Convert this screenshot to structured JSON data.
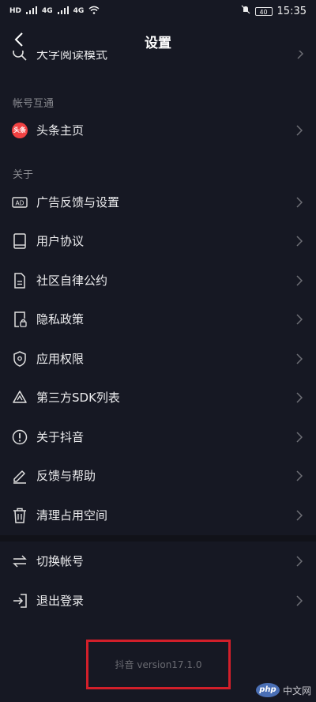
{
  "status_bar": {
    "left_tags": [
      "HD",
      "4G",
      "4G"
    ],
    "time": "15:35",
    "battery": "40",
    "icons": [
      "signal-icon",
      "wifi-icon",
      "mute-bell-icon",
      "battery-icon"
    ]
  },
  "header": {
    "title": "设置",
    "back_icon": "chevron-left-icon"
  },
  "partial_item": {
    "label": "大字阅读模式",
    "icon": "search-icon"
  },
  "sections": {
    "account_link_label": "帐号互通",
    "about_label": "关于"
  },
  "account_items": [
    {
      "label": "头条主页",
      "icon": "toutiao-logo-icon",
      "badge": "头条"
    }
  ],
  "about_items": [
    {
      "label": "广告反馈与设置",
      "icon": "ad-icon"
    },
    {
      "label": "用户协议",
      "icon": "book-icon"
    },
    {
      "label": "社区自律公约",
      "icon": "document-icon"
    },
    {
      "label": "隐私政策",
      "icon": "privacy-lock-icon"
    },
    {
      "label": "应用权限",
      "icon": "shield-icon"
    },
    {
      "label": "第三方SDK列表",
      "icon": "recycle-icon"
    },
    {
      "label": "关于抖音",
      "icon": "info-circle-icon"
    },
    {
      "label": "反馈与帮助",
      "icon": "pencil-icon"
    },
    {
      "label": "清理占用空间",
      "icon": "trash-icon"
    }
  ],
  "account_actions": [
    {
      "label": "切换帐号",
      "icon": "switch-arrows-icon"
    },
    {
      "label": "退出登录",
      "icon": "logout-icon"
    }
  ],
  "footer": {
    "version": "抖音 version17.1.0",
    "highlight_color": "#d21f2a"
  },
  "watermark": {
    "logo": "php",
    "text": "中文网"
  },
  "colors": {
    "background": "#161823",
    "text": "#ececee",
    "muted": "#8a8b91"
  }
}
